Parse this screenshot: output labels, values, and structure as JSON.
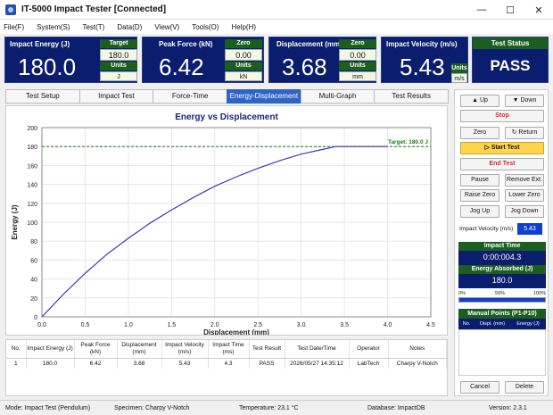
{
  "window": {
    "title": "IT-5000 Impact Tester   [Connected]",
    "minimize": "—",
    "maximize": "☐",
    "close": "✕"
  },
  "menu": [
    "File(F)",
    "System(S)",
    "Test(T)",
    "Data(D)",
    "View(V)",
    "Tools(O)",
    "Help(H)"
  ],
  "panels": {
    "energy": {
      "label": "Impact Energy (J)",
      "value": "180.0",
      "side_hdr1": "Target",
      "side_val": "180.0",
      "side_hdr2": "Units",
      "side_unit": "J"
    },
    "force": {
      "label": "Peak Force  (kN)",
      "value": "6.42",
      "side_hdr1": "Zero",
      "side_val": "0.00",
      "side_hdr2": "Units",
      "side_unit": "kN"
    },
    "disp": {
      "label": "Displacement (mm)",
      "value": "3.68",
      "side_hdr1": "Zero",
      "side_val": "0.00",
      "side_hdr2": "Units",
      "side_unit": "mm"
    },
    "velocity": {
      "label": "Impact Velocity (m/s)",
      "value": "5.43",
      "side_hdr2": "Units",
      "side_unit": "m/s"
    },
    "status": {
      "label": "Test Status",
      "value": "PASS"
    }
  },
  "tabs": [
    "Test Setup",
    "Impact Test",
    "Force-Time",
    "Energy-Displacement",
    "Multi-Graph",
    "Test Results"
  ],
  "active_tab": 3,
  "chart_data": {
    "type": "line",
    "title": "Energy vs Displacement",
    "xlabel": "Displacement (mm)",
    "ylabel": "Energy (J)",
    "xlim": [
      0,
      4.5
    ],
    "ylim": [
      0,
      200
    ],
    "xticks": [
      "0.0",
      "0.5",
      "1.0",
      "1.5",
      "2.0",
      "2.5",
      "3.0",
      "3.5",
      "4.0",
      "4.5"
    ],
    "yticks": [
      "0",
      "20",
      "40",
      "60",
      "80",
      "100",
      "120",
      "140",
      "160",
      "180",
      "200"
    ],
    "grid": true,
    "series": [
      {
        "x": [
          0,
          0.25,
          0.5,
          0.75,
          1.0,
          1.25,
          1.5,
          1.75,
          2.0,
          2.25,
          2.5,
          2.75,
          3.0,
          3.25,
          3.4,
          3.6,
          3.8,
          4.0
        ],
        "y": [
          0,
          24,
          46,
          66,
          83,
          99,
          113,
          126,
          138,
          148,
          157,
          165,
          172,
          177,
          180,
          180,
          180,
          180
        ],
        "color": "#3b3bb0"
      }
    ],
    "target": {
      "y": 180,
      "label": "Target: 180.0 J",
      "color": "#1b7a1b"
    }
  },
  "right": {
    "up": "▲ Up",
    "down": "▼ Down",
    "stop": "Stop",
    "zero": "Zero",
    "return": "↻ Return",
    "start": "▷ Start Test",
    "end": "End Test",
    "pause": "Pause",
    "remove": "Remove Ext.",
    "raise": "Raise Zero",
    "lower": "Lower Zero",
    "jogup": "Jog Up",
    "jogdown": "Jog Down",
    "vel_label": "Impact Velocity (m/s)",
    "vel_value": "5.43",
    "time_hdr": "Impact Time",
    "time_val": "0:00:004.3",
    "absorbed_hdr": "Energy Absorbed (J)",
    "absorbed_val": "180.0",
    "prog": [
      "0%",
      "50%",
      "100%"
    ],
    "progress": 1.0,
    "manual_hdr": "Manual Points (P1-P10)",
    "manual_cols": [
      "No.",
      "Displ. (mm)",
      "Energy (J)"
    ],
    "cancel": "Cancel",
    "delete": "Delete"
  },
  "table": {
    "headers": [
      "No.",
      "Impact Energy (J)",
      "Peak Force (kN)",
      "Displacement (mm)",
      "Impact Velocity (m/s)",
      "Impact Time (ms)",
      "Test Result",
      "Test Date/Time",
      "Operator",
      "Notes"
    ],
    "rows": [
      [
        "1",
        "180.0",
        "6.42",
        "3.68",
        "5.43",
        "4.3",
        "PASS",
        "2026/05/27 14:35:12",
        "LabTech",
        "Charpy V-Notch"
      ]
    ]
  },
  "statusbar": {
    "mode": "Mode: Impact Test (Pendulum)",
    "specimen": "Specimen:  Charpy V-Notch",
    "temp": "Temperature:    23.1 °C",
    "db": "Database:  ImpactDB",
    "version": "Version:   2.3.1"
  }
}
